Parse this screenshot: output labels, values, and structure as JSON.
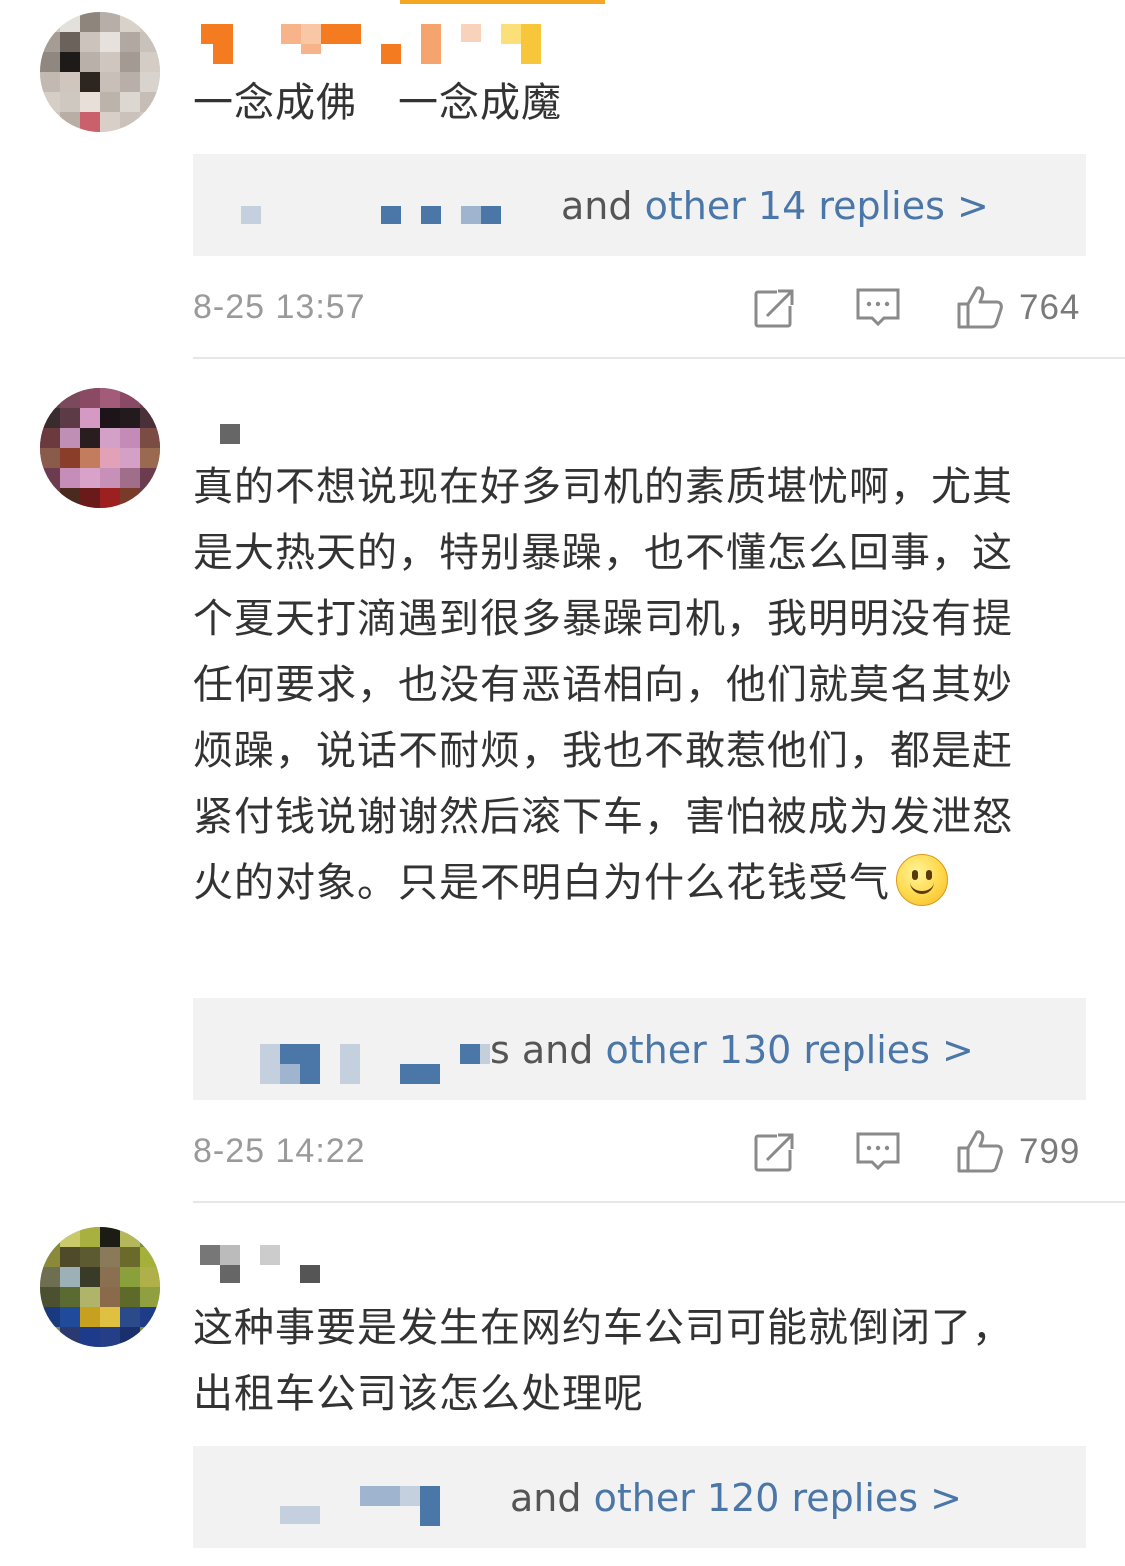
{
  "comments": [
    {
      "text": "一念成佛　一念成魔",
      "replies": {
        "prefix": "and",
        "link": "other 14 replies >"
      },
      "timestamp": "8-25 13:57",
      "likes": "764",
      "share_icon": "share-icon",
      "comment_icon": "comment-icon",
      "like_icon": "thumbs-up-icon"
    },
    {
      "text": "真的不想说现在好多司机的素质堪忧啊，尤其是大热天的，特别暴躁，也不懂怎么回事，这个夏天打滴遇到很多暴躁司机，我明明没有提任何要求，也没有恶语相向，他们就莫名其妙烦躁，说话不耐烦，我也不敢惹他们，都是赶紧付钱说谢谢然后滚下车，害怕被成为发泄怒火的对象。只是不明白为什么花钱受气",
      "emoji": "smile-emoji",
      "replies": {
        "prefix": "s and",
        "link": "other 130 replies >"
      },
      "timestamp": "8-25 14:22",
      "likes": "799",
      "share_icon": "share-icon",
      "comment_icon": "comment-icon",
      "like_icon": "thumbs-up-icon"
    },
    {
      "text": "这种事要是发生在网约车公司可能就倒闭了，出租车公司该怎么处理呢",
      "replies": {
        "prefix": "and",
        "link": "other 120 replies >"
      }
    }
  ],
  "colors": {
    "link_blue": "#4a76a8",
    "text_dark": "#333333",
    "meta_gray": "#9a9a9a",
    "reply_bg": "#f2f2f2",
    "accent_orange": "#f5a623"
  }
}
